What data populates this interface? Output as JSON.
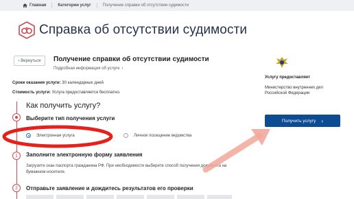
{
  "breadcrumb": {
    "home": "Главная",
    "category": "Категории услуг",
    "current": "Получение справки об отсутствии судимости"
  },
  "page": {
    "title": "Справка об отсутствии судимости"
  },
  "back_button": "Вернуться",
  "service": {
    "name": "Получение справки об отсутствии судимости",
    "info_link": "Подробная информация об услуге",
    "term_label": "Сроки оказания услуги:",
    "term_value": "30 календарных дней",
    "cost_label": "Стоимость услуги:",
    "cost_value": "Услуга предоставляется бесплатно."
  },
  "how_to": {
    "title": "Как получить услугу?",
    "step1_title": "Выберите тип получения услуги",
    "options": [
      {
        "label": "Электронная услуга",
        "selected": true
      },
      {
        "label": "Личное посещение ведомства",
        "selected": false
      }
    ],
    "step2_number": "1",
    "step2_title": "Заполните электронную форму заявления",
    "step2_desc": "Загрузите скан паспорта гражданина РФ. При необходимости выберите способ получения документа на бумажном носителе.",
    "step3_number": "2",
    "step3_title": "Отправьте заявление и дождитесь результатов его проверки"
  },
  "provider": {
    "label": "Услугу предоставляет",
    "name": "Министерство внутренних дел Российской Федерации"
  },
  "get_button": "Получить услугу",
  "colors": {
    "accent_red": "#c94a52",
    "button_blue": "#0d4c92",
    "annotation_red": "#e8201c",
    "arrow": "#f2a79c"
  }
}
